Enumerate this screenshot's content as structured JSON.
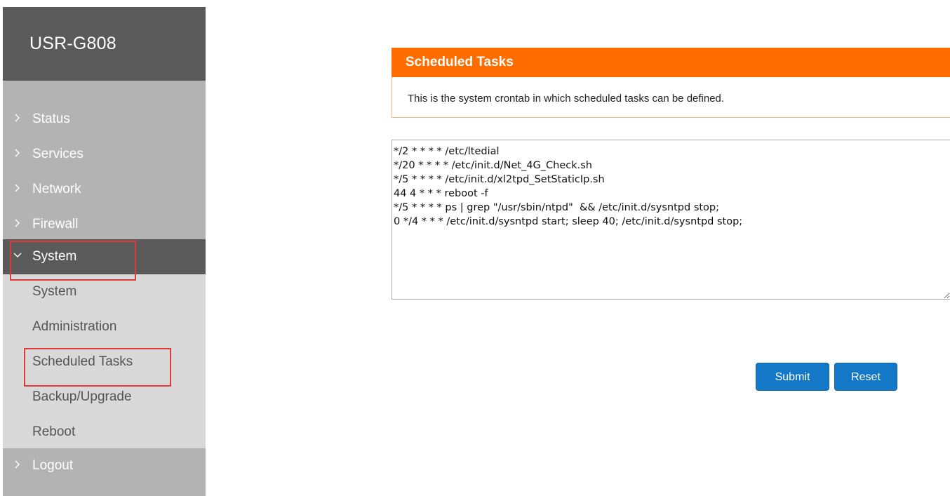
{
  "app": {
    "brand": "USR-G808"
  },
  "sidebar": {
    "items": [
      {
        "label": "Status",
        "expanded": false
      },
      {
        "label": "Services",
        "expanded": false
      },
      {
        "label": "Network",
        "expanded": false
      },
      {
        "label": "Firewall",
        "expanded": false
      },
      {
        "label": "System",
        "expanded": true
      },
      {
        "label": "Logout",
        "expanded": false
      }
    ],
    "system_subitems": [
      {
        "label": "System"
      },
      {
        "label": "Administration"
      },
      {
        "label": "Scheduled Tasks"
      },
      {
        "label": "Backup/Upgrade"
      },
      {
        "label": "Reboot"
      }
    ]
  },
  "panel": {
    "title": "Scheduled Tasks",
    "description": "This is the system crontab in which scheduled tasks can be defined."
  },
  "crontab": {
    "value": "*/2 * * * * /etc/ltedial\n*/20 * * * * /etc/init.d/Net_4G_Check.sh\n*/5 * * * * /etc/init.d/xl2tpd_SetStaticIp.sh\n44 4 * * * reboot -f\n*/5 * * * * ps | grep \"/usr/sbin/ntpd\"  && /etc/init.d/sysntpd stop;\n0 */4 * * * /etc/init.d/sysntpd start; sleep 40; /etc/init.d/sysntpd stop;"
  },
  "buttons": {
    "submit": "Submit",
    "reset": "Reset"
  },
  "colors": {
    "header_orange": "#ff6c00",
    "button_blue": "#1378c8",
    "highlight_red": "#e0393c",
    "sidebar_dark": "#5a5a5a",
    "sidebar_gray": "#b3b3b3"
  },
  "icons": {
    "collapsed": "chevron-right-icon",
    "expanded": "chevron-down-icon"
  }
}
